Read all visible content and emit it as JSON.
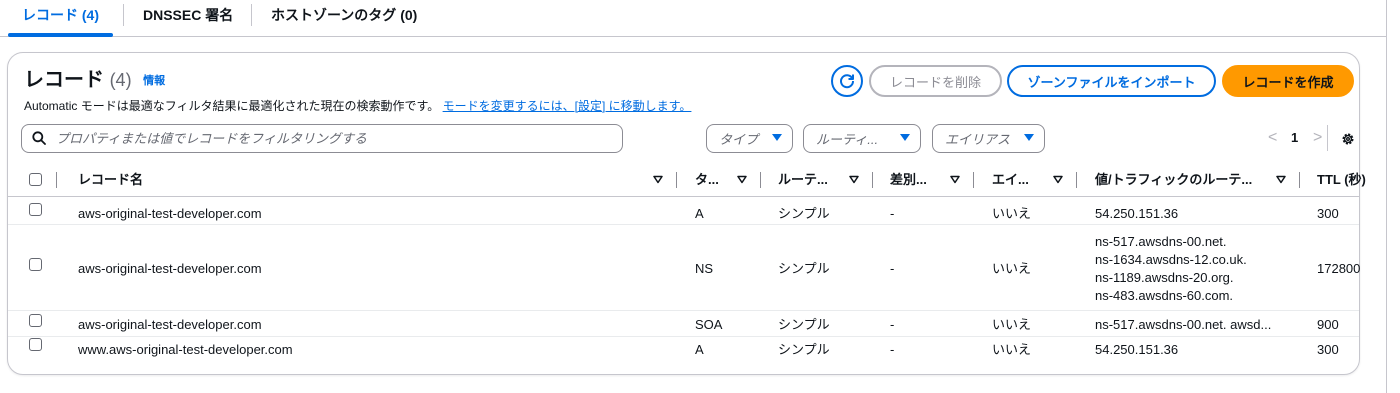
{
  "tabs": [
    {
      "label": "レコード (4)",
      "active": true
    },
    {
      "label": "DNSSEC 署名",
      "active": false
    },
    {
      "label": "ホストゾーンのタグ (0)",
      "active": false
    }
  ],
  "panel": {
    "title": "レコード",
    "count": "(4)",
    "info_link": "情報",
    "description": "Automatic モードは最適なフィルタ結果に最適化された現在の検索動作です。",
    "description_link": "モードを変更するには、[設定] に移動します。"
  },
  "actions": {
    "refresh_icon": "refresh-icon",
    "delete_label": "レコードを削除",
    "import_label": "ゾーンファイルをインポート",
    "create_label": "レコードを作成"
  },
  "filter": {
    "search_placeholder": "プロパティまたは値でレコードをフィルタリングする",
    "type_dropdown": "タイプ",
    "routing_dropdown": "ルーティ...",
    "alias_dropdown": "エイリアス"
  },
  "pagination": {
    "prev": "<",
    "current_page": "1",
    "next": ">"
  },
  "table": {
    "columns": [
      "レコード名",
      "タ...",
      "ルーテ...",
      "差別...",
      "エイ...",
      "値/トラフィックのルーテ...",
      "TTL (秒)"
    ],
    "rows": [
      {
        "name": "aws-original-test-developer.com",
        "type": "A",
        "routing": "シンプル",
        "diff": "-",
        "alias": "いいえ",
        "value": [
          "54.250.151.36"
        ],
        "ttl": "300"
      },
      {
        "name": "aws-original-test-developer.com",
        "type": "NS",
        "routing": "シンプル",
        "diff": "-",
        "alias": "いいえ",
        "value": [
          "ns-517.awsdns-00.net.",
          "ns-1634.awsdns-12.co.uk.",
          "ns-1189.awsdns-20.org.",
          "ns-483.awsdns-60.com."
        ],
        "ttl": "172800"
      },
      {
        "name": "aws-original-test-developer.com",
        "type": "SOA",
        "routing": "シンプル",
        "diff": "-",
        "alias": "いいえ",
        "value": [
          "ns-517.awsdns-00.net. awsd..."
        ],
        "ttl": "900"
      },
      {
        "name": "www.aws-original-test-developer.com",
        "type": "A",
        "routing": "シンプル",
        "diff": "-",
        "alias": "いいえ",
        "value": [
          "54.250.151.36"
        ],
        "ttl": "300"
      }
    ]
  },
  "colors": {
    "accent": "#006ce0",
    "primary_button": "#ff9900",
    "border": "#c6c6cd",
    "text": "#0f141a"
  }
}
